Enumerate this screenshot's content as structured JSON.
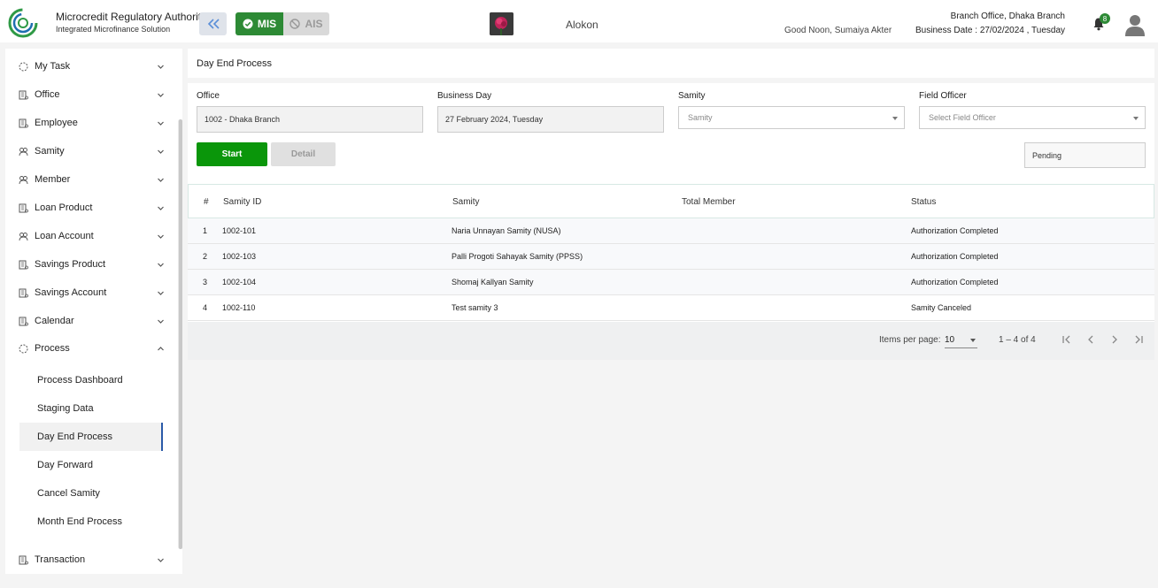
{
  "header": {
    "brand_title": "Microcredit Regulatory Authority",
    "brand_subtitle": "Integrated Microfinance Solution",
    "logo_text": "Microcredit Regulatory Authority",
    "mis_label": "MIS",
    "ais_label": "AIS",
    "center_brand": "Alokon",
    "greeting": "Good Noon, Sumaiya Akter",
    "office_name": "Branch Office, Dhaka Branch",
    "business_date": "Business Date : 27/02/2024 , Tuesday",
    "notification_count": "8",
    "accent_green": "#2d8a35"
  },
  "sidebar": {
    "items": [
      {
        "label": "My Task",
        "icon": "task-icon"
      },
      {
        "label": "Office",
        "icon": "office-icon"
      },
      {
        "label": "Employee",
        "icon": "employee-icon"
      },
      {
        "label": "Samity",
        "icon": "samity-icon"
      },
      {
        "label": "Member",
        "icon": "member-icon"
      },
      {
        "label": "Loan Product",
        "icon": "loan-product-icon"
      },
      {
        "label": "Loan Account",
        "icon": "loan-account-icon"
      },
      {
        "label": "Savings Product",
        "icon": "savings-product-icon"
      },
      {
        "label": "Savings Account",
        "icon": "savings-account-icon"
      },
      {
        "label": "Calendar",
        "icon": "calendar-icon"
      },
      {
        "label": "Process",
        "icon": "process-icon"
      }
    ],
    "process_subitems": [
      {
        "label": "Process Dashboard"
      },
      {
        "label": "Staging Data"
      },
      {
        "label": "Day End Process"
      },
      {
        "label": "Day Forward"
      },
      {
        "label": "Cancel Samity"
      },
      {
        "label": "Month End Process"
      }
    ],
    "transaction": {
      "label": "Transaction",
      "icon": "transaction-icon"
    }
  },
  "page": {
    "title": "Day End Process"
  },
  "form": {
    "office_label": "Office",
    "office_value": "1002 - Dhaka Branch",
    "business_day_label": "Business Day",
    "business_day_value": "27 February 2024, Tuesday",
    "samity_label": "Samity",
    "samity_placeholder": "Samity",
    "field_officer_label": "Field Officer",
    "field_officer_placeholder": "Select Field Officer",
    "start_label": "Start",
    "detail_label": "Detail",
    "status_value": "Pending"
  },
  "table": {
    "headers": [
      "#",
      "Samity ID",
      "Samity",
      "Total Member",
      "Status"
    ],
    "rows": [
      {
        "num": "1",
        "samity_id": "1002-101",
        "samity": "Naria Unnayan Samity (NUSA)",
        "total_member": "",
        "status": "Authorization Completed"
      },
      {
        "num": "2",
        "samity_id": "1002-103",
        "samity": "Palli Progoti Sahayak Samity (PPSS)",
        "total_member": "",
        "status": "Authorization Completed"
      },
      {
        "num": "3",
        "samity_id": "1002-104",
        "samity": "Shomaj Kallyan Samity",
        "total_member": "",
        "status": "Authorization Completed"
      },
      {
        "num": "4",
        "samity_id": "1002-110",
        "samity": "Test samity 3",
        "total_member": "",
        "status": "Samity Canceled"
      }
    ]
  },
  "pager": {
    "items_per_page_label": "Items per page:",
    "items_per_page_value": "10",
    "range": "1 – 4 of 4"
  }
}
